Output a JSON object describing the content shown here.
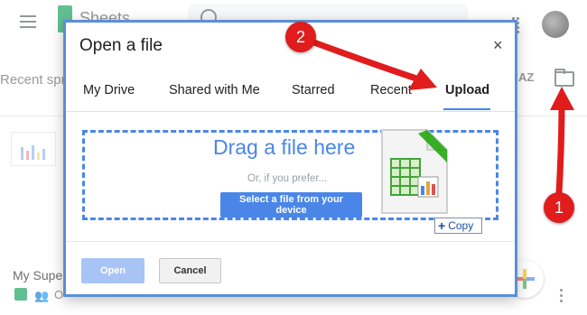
{
  "background": {
    "app_title": "Sheets",
    "recent_label": "Recent spreadsheets",
    "sort_icon_text": "AZ",
    "doc_title": "My Super Spreadsheet",
    "doc_meta": "O"
  },
  "dialog": {
    "title": "Open a file",
    "close": "×",
    "tabs": [
      {
        "label": "My Drive"
      },
      {
        "label": "Shared with Me"
      },
      {
        "label": "Starred"
      },
      {
        "label": "Recent"
      },
      {
        "label": "Upload",
        "active": true
      }
    ],
    "upload": {
      "drag_text": "Drag a file here",
      "prefer_text": "Or, if you prefer...",
      "select_button": "Select a file from your device",
      "copy_tooltip": "Copy"
    },
    "footer": {
      "open_label": "Open",
      "cancel_label": "Cancel"
    }
  },
  "annotations": {
    "badge_1": "1",
    "badge_2": "2",
    "color": "#e01c1c"
  },
  "colors": {
    "accent": "#4a86e8",
    "dialog_border": "#5b8fd6",
    "sheets_green": "#0f9d58"
  }
}
